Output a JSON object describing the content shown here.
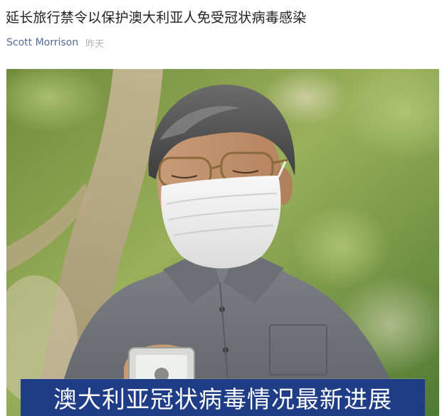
{
  "article": {
    "title": "延长旅行禁令以保护澳大利亚人免受冠状病毒感染",
    "author": "Scott Morrison",
    "time": "昨天"
  },
  "hero_image": {
    "description_icon": "masked-man-photo",
    "banner_text": "澳大利亚冠状病毒情况最新进展",
    "banner_color": "#1f3c86"
  },
  "colors": {
    "title": "#222222",
    "author_link": "#576b95",
    "timestamp": "#b2b2b2"
  }
}
